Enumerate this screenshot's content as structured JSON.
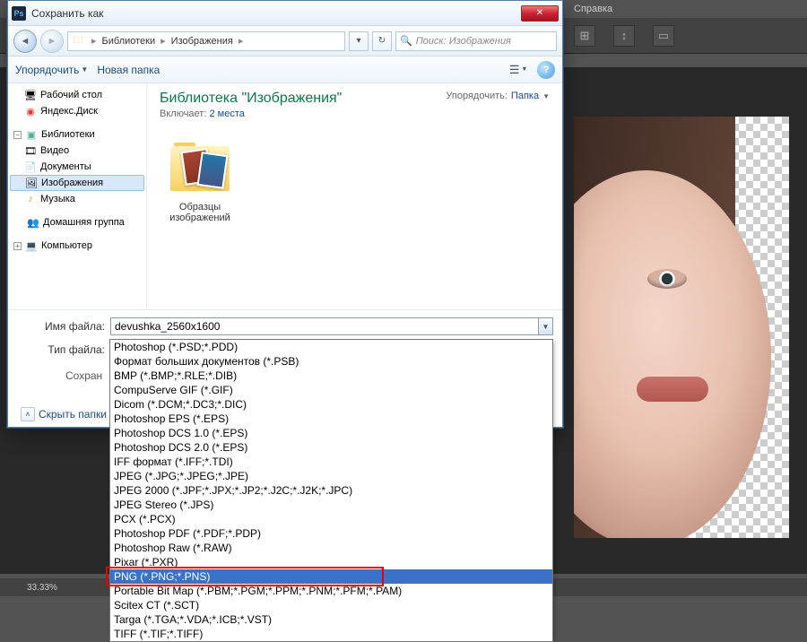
{
  "ps": {
    "menu_help": "Справка",
    "status": "33.33%"
  },
  "dialog": {
    "title": "Сохранить как",
    "breadcrumb": {
      "root": "Библиотеки",
      "folder": "Изображения"
    },
    "search_placeholder": "Поиск: Изображения",
    "toolbar": {
      "organize": "Упорядочить",
      "newfolder": "Новая папка"
    },
    "tree": {
      "desktop": "Рабочий стол",
      "yadisk": "Яндекс.Диск",
      "libraries": "Библиотеки",
      "video": "Видео",
      "documents": "Документы",
      "images": "Изображения",
      "music": "Музыка",
      "homegroup": "Домашняя группа",
      "computer": "Компьютер"
    },
    "content": {
      "title": "Библиотека \"Изображения\"",
      "includes": "Включает:",
      "places": "2 места",
      "sort_label": "Упорядочить:",
      "sort_value": "Папка",
      "folder_name": "Образцы изображений"
    },
    "form": {
      "name_label": "Имя файла:",
      "name_value": "devushka_2560x1600",
      "type_label": "Тип файла:",
      "type_value": "Photoshop (*.PSD;*.PDD)",
      "save_label": "Сохран",
      "hide_folders": "Скрыть папки"
    },
    "filetypes": [
      "Photoshop (*.PSD;*.PDD)",
      "Формат больших документов (*.PSB)",
      "BMP (*.BMP;*.RLE;*.DIB)",
      "CompuServe GIF (*.GIF)",
      "Dicom (*.DCM;*.DC3;*.DIC)",
      "Photoshop EPS (*.EPS)",
      "Photoshop DCS 1.0 (*.EPS)",
      "Photoshop DCS 2.0 (*.EPS)",
      "IFF формат (*.IFF;*.TDI)",
      "JPEG (*.JPG;*.JPEG;*.JPE)",
      "JPEG 2000 (*.JPF;*.JPX;*.JP2;*.J2C;*.J2K;*.JPC)",
      "JPEG Stereo (*.JPS)",
      "PCX (*.PCX)",
      "Photoshop PDF (*.PDF;*.PDP)",
      "Photoshop Raw (*.RAW)",
      "Pixar (*.PXR)",
      "PNG (*.PNG;*.PNS)",
      "Portable Bit Map (*.PBM;*.PGM;*.PPM;*.PNM;*.PFM;*.PAM)",
      "Scitex CT (*.SCT)",
      "Targa (*.TGA;*.VDA;*.ICB;*.VST)",
      "TIFF (*.TIF;*.TIFF)"
    ],
    "highlighted_index": 16
  }
}
